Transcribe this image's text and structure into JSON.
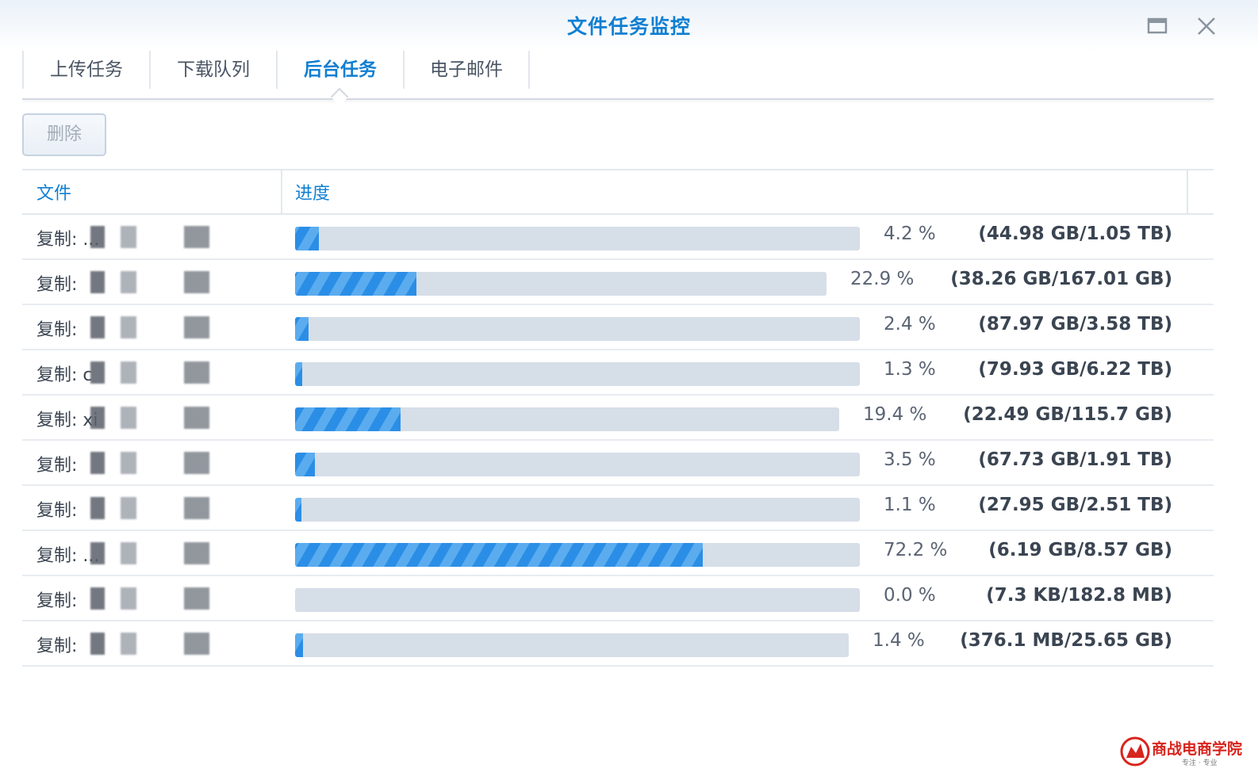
{
  "window": {
    "title": "文件任务监控"
  },
  "tabs": [
    {
      "label": "上传任务",
      "active": false
    },
    {
      "label": "下载队列",
      "active": false
    },
    {
      "label": "后台任务",
      "active": true
    },
    {
      "label": "电子邮件",
      "active": false
    }
  ],
  "toolbar": {
    "delete_label": "删除"
  },
  "table": {
    "columns": [
      "文件",
      "进度"
    ],
    "rows": [
      {
        "file": "复制: ...",
        "progress": 0.042,
        "percent": "4.2 %",
        "size": "(44.98 GB/1.05 TB)"
      },
      {
        "file": "复制: ",
        "progress": 0.229,
        "percent": "22.9 %",
        "size": "(38.26 GB/167.01 GB)"
      },
      {
        "file": "复制: ",
        "progress": 0.024,
        "percent": "2.4 %",
        "size": "(87.97 GB/3.58 TB)"
      },
      {
        "file": "复制: c",
        "progress": 0.013,
        "percent": "1.3 %",
        "size": "(79.93 GB/6.22 TB)"
      },
      {
        "file": "复制: xi",
        "progress": 0.194,
        "percent": "19.4 %",
        "size": "(22.49 GB/115.7 GB)"
      },
      {
        "file": "复制: ",
        "progress": 0.035,
        "percent": "3.5 %",
        "size": "(67.73 GB/1.91 TB)"
      },
      {
        "file": "复制: ",
        "progress": 0.011,
        "percent": "1.1 %",
        "size": "(27.95 GB/2.51 TB)"
      },
      {
        "file": "复制: ...",
        "progress": 0.722,
        "percent": "72.2 %",
        "size": "(6.19 GB/8.57 GB)"
      },
      {
        "file": "复制: ",
        "progress": 0.0,
        "percent": "0.0 %",
        "size": "(7.3 KB/182.8 MB)"
      },
      {
        "file": "复制: ",
        "progress": 0.014,
        "percent": "1.4 %",
        "size": "(376.1 MB/25.65 GB)"
      }
    ]
  },
  "watermark": {
    "text": "商战电商学院",
    "sub": "专注 · 专业"
  },
  "colors": {
    "accent": "#0f7fd2",
    "bar_fill": "#2b8ee6",
    "bar_track": "#d6dee8"
  }
}
